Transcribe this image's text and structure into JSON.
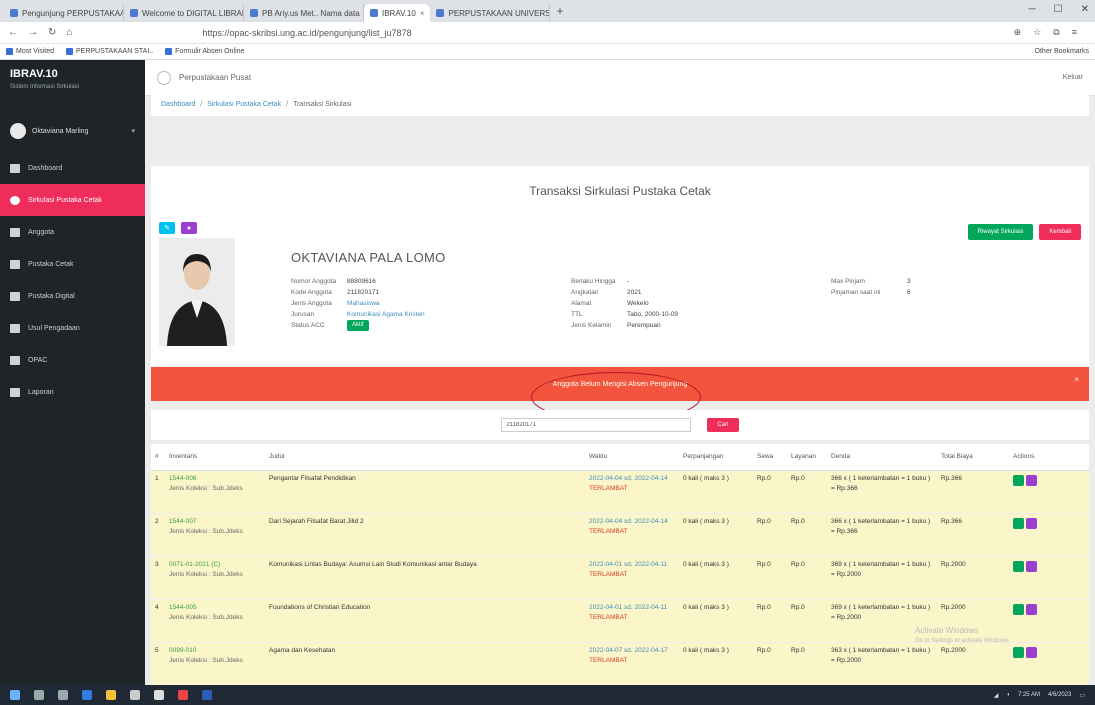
{
  "browser": {
    "tabs": [
      {
        "label": "Pengunjung PERPUSTAKAAN |"
      },
      {
        "label": "Welcome to DIGITAL LIBRARY"
      },
      {
        "label": "PB Ariy.us Met.. Nama data"
      },
      {
        "label": "IBRAV.10",
        "active": true
      },
      {
        "label": "PERPUSTAKAAN UNIVERSITAS"
      }
    ],
    "url": "https://opac-skribsi.ung.ac.id/pengunjung/list_ju7878",
    "bookmarks": [
      {
        "label": "Most Visited"
      },
      {
        "label": "PERPUSTAKAAN STAI.."
      },
      {
        "label": "Formulir Absen Online"
      }
    ],
    "other_bookmarks": "Other Bookmarks"
  },
  "sidebar": {
    "brand": "IBRAV.10",
    "brand_sub": "Sistem Informasi Sirkulasi",
    "user": "Oktaviana Marling",
    "items": [
      {
        "label": "Dashboard"
      },
      {
        "label": "Sirkulasi Pustaka Cetak",
        "active": true
      },
      {
        "label": "Anggota"
      },
      {
        "label": "Pustaka Cetak"
      },
      {
        "label": "Pustaka Digital"
      },
      {
        "label": "Usul Pengadaan"
      },
      {
        "label": "OPAC"
      },
      {
        "label": "Laporan"
      }
    ]
  },
  "topbar": {
    "title": "Perpustakaan Pusat",
    "logout": "Keluar"
  },
  "breadcrumb": {
    "items": [
      "Dashboard",
      "Sirkulasi Pustaka Cetak"
    ],
    "current": "Transaksi Sirkulasi"
  },
  "page_title": "Transaksi Sirkulasi Pustaka Cetak",
  "member": {
    "name": "OKTAVIANA PALA LOMO",
    "col1": [
      {
        "k": "Nomor Anggota",
        "v": "88809616"
      },
      {
        "k": "Kode Anggota",
        "v": "211820171"
      },
      {
        "k": "Jenis Anggota",
        "v": "Mahasiswa"
      },
      {
        "k": "Jurusan",
        "v": "Komunikasi Agama Kristen"
      },
      {
        "k": "Status ACC",
        "v": "Aktif"
      }
    ],
    "col2": [
      {
        "k": "Berlaku Hingga",
        "v": "-"
      },
      {
        "k": "Angkatan",
        "v": "2021"
      },
      {
        "k": "Alamat",
        "v": "Wekelo"
      },
      {
        "k": "TTL",
        "v": "Tabo, 2000-10-09"
      },
      {
        "k": "Jenis Kelamin",
        "v": "Perempuan"
      }
    ],
    "col3": [
      {
        "k": "Max Pinjam",
        "v": "3"
      },
      {
        "k": "Pinjaman saat ini",
        "v": "6"
      }
    ],
    "btn_riwayat": "Riwayat Sirkulasi",
    "btn_kembali": "Kembali"
  },
  "alert": {
    "message": "Anggota Belum Mengisi Absen Pengunjung"
  },
  "search": {
    "value": "211820171",
    "button": "Cari"
  },
  "table": {
    "headers": [
      "#",
      "Inventaris",
      "Judul",
      "Waktu",
      "Perpanjangan",
      "Sewa",
      "Layanan",
      "Denda",
      "Total Biaya",
      "Actions"
    ],
    "rows": [
      {
        "no": "1",
        "inv": "1544-008",
        "sub": "Jenis Koleksi : Sub.Jdeks",
        "judul": "Pengantar Filsafat Pendidikan",
        "waktu": "2022-04-04 sd. 2022-04-14",
        "status": "TERLAMBAT",
        "perp": "0 kali ( maks 3 )",
        "sewa": "Rp.0",
        "layanan": "Rp.0",
        "denda": "366 x ( 1 keterlambatan = 1 buku )",
        "denda2": "= Rp.366",
        "total": "Rp.366"
      },
      {
        "no": "2",
        "inv": "1544-007",
        "sub": "Jenis Koleksi : Sub.Jdeks",
        "judul": "Dari Sejarah Filsafat Barat Jilid 2",
        "waktu": "2022-04-04 sd. 2022-04-14",
        "status": "TERLAMBAT",
        "perp": "0 kali ( maks 3 )",
        "sewa": "Rp.0",
        "layanan": "Rp.0",
        "denda": "366 x ( 1 keterlambatan = 1 buku )",
        "denda2": "= Rp.366",
        "total": "Rp.366"
      },
      {
        "no": "3",
        "inv": "0071-01-2021 (C)",
        "sub": "Jenis Koleksi : Sub.Jdeks",
        "judul": "Komunikasi Lintas Budaya: Asumsi Lain Studi Komunikasi antar Budaya",
        "waktu": "2022-04-01 sd. 2022-04-11",
        "status": "TERLAMBAT",
        "perp": "0 kali ( maks 3 )",
        "sewa": "Rp.0",
        "layanan": "Rp.0",
        "denda": "369 x ( 1 keterlambatan = 1 buku )",
        "denda2": "= Rp.2000",
        "total": "Rp.2000"
      },
      {
        "no": "4",
        "inv": "1544-005",
        "sub": "Jenis Koleksi : Sub.Jdeks",
        "judul": "Foundations of Christian Education",
        "waktu": "2022-04-01 sd. 2022-04-11",
        "status": "TERLAMBAT",
        "perp": "0 kali ( maks 3 )",
        "sewa": "Rp.0",
        "layanan": "Rp.0",
        "denda": "369 x ( 1 keterlambatan = 1 buku )",
        "denda2": "= Rp.2000",
        "total": "Rp.2000"
      },
      {
        "no": "5",
        "inv": "0099-010",
        "sub": "Jenis Koleksi : Sub.Jdeks",
        "judul": "Agama dan Kesehatan",
        "waktu": "2022-04-07 sd. 2022-04-17",
        "status": "TERLAMBAT",
        "perp": "0 kali ( maks 3 )",
        "sewa": "Rp.0",
        "layanan": "Rp.0",
        "denda": "363 x ( 1 keterlambatan = 1 buku )",
        "denda2": "= Rp.2000",
        "total": "Rp.2000"
      }
    ]
  },
  "watermark": {
    "title": "Activate Windows",
    "sub": "Go to Settings to activate Windows."
  },
  "tray": {
    "time": "7:25 AM",
    "date": "4/6/2023"
  }
}
